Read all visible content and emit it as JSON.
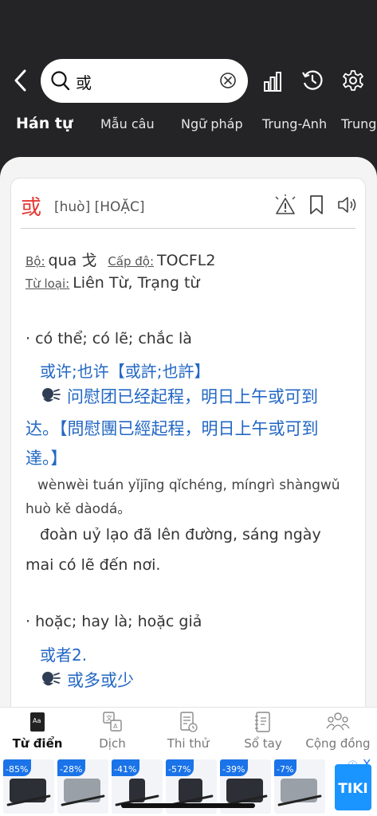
{
  "search": {
    "query": "或"
  },
  "tabs": [
    "Hán tự",
    "Mẫu câu",
    "Ngữ pháp",
    "Trung-Anh",
    "Trung-"
  ],
  "entry": {
    "headword": "或",
    "reading": "[huò] [HOẶC]",
    "radical_label": "Bộ:",
    "radical_value": "qua 戈",
    "level_label": "Cấp độ:",
    "level_value": "TOCFL2",
    "pos_label": "Từ loại:",
    "pos_value": "Liên Từ, Trạng từ"
  },
  "senses": [
    {
      "meaning": "· có thể; có lẽ; chắc là",
      "words": "或许;也许【或許;也許】",
      "example_zh_lines": [
        "问慰团已经起程，明日上午或可到",
        "达。【問慰團已經起程，明日上午或可到",
        "達。】"
      ],
      "example_pinyin": "wènwèi tuán yǐjīng qǐchéng, míngrì shàngwǔ huò kě dàodá。",
      "example_vi": "đoàn uỷ lạo đã lên đường, sáng ngày mai có lẽ đến nơi."
    },
    {
      "meaning": "· hoặc; hay là; hoặc giả",
      "words": "或者2.",
      "example_zh_lines": [
        "或多或少"
      ]
    }
  ],
  "bottom_nav": [
    "Từ điển",
    "Dịch",
    "Thi thử",
    "Sổ tay",
    "Cộng đồng"
  ],
  "ads": {
    "discounts": [
      "-85%",
      "-28%",
      "-41%",
      "-57%",
      "-39%",
      "-7%"
    ],
    "brand": "TIKI",
    "info": "ⓘ",
    "close": "X"
  },
  "colors": {
    "headword": "#e53935",
    "link": "#2267c4",
    "topbar": "#242426",
    "tiki": "#1a94ff"
  }
}
